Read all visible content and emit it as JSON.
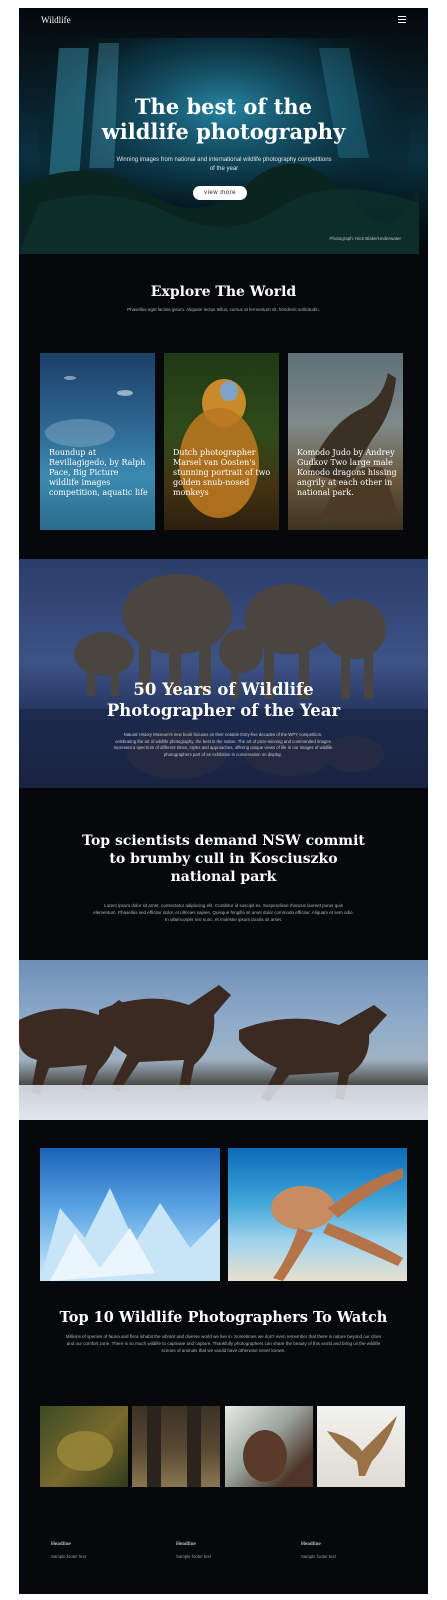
{
  "header": {
    "logo": "Wildlife",
    "menu_icon": "hamburger-menu-icon"
  },
  "hero": {
    "title_line1": "The best of the",
    "title_line2": "wildlife photography",
    "subtitle": "Winning images from national and international wildlife photography competitions of the year",
    "button_label": "view more",
    "credit": "Photograph: Nick Blake/Underwater"
  },
  "explore": {
    "title": "Explore The World",
    "text": "Phasellus eget lacinia ipsum. Aliquam lectus tellus, cursus at fermentum sit, hendrerit sollicitudin."
  },
  "cards": [
    {
      "caption": "Roundup at Revillagigedo, by Ralph Pace, Big Picture wildlife images competition, aquatic life"
    },
    {
      "caption": "Dutch photographer Marsel van Oosten's stunning portrait of two golden snub-nosed monkeys"
    },
    {
      "caption": "Komodo Judo by Andrey Gudkov Two large male Komodo dragons hissing angrily at each other in national park."
    }
  ],
  "feature": {
    "title_line1": "50 Years of Wildlife",
    "title_line2": "Photographer of the Year",
    "text": "Natural History Museum's new book focuses on their notable thirty-five decades of the WPY competition, celebrating the art of wildlife photography, the best in the nation. The art of prize-winning and commended images represent a spectrum of different times, styles and approaches, offering unique views of life in our images of wildlife photographers part of an exhibition in conversation on display."
  },
  "article": {
    "title_line1": "Top scientists demand NSW commit",
    "title_line2": "to brumby cull in Kosciuszko",
    "title_line3": "national park",
    "text": "Lorem ipsum dolor sit amet, consectetur adipiscing elit. Curabitur id suscipit ex. Suspendisse rhoncus laoreet purus quis elementum. Phasellus sed efficitur dolor, et ultricies sapien. Quisque fringilla sit amet dolor commodo efficitur. Aliquam et sem odio. In ullamcorper nisi nunc, et molestie ipsum iaculis sit amet."
  },
  "top10": {
    "title": "Top 10 Wildlife Photographers To Watch",
    "text": "Millions of species of fauna and flora inhabit the vibrant and diverse world we live in. Sometimes we don't even remember that there is nature beyond our cities and our comfort zone. There is so much wildlife to captivate and capture. Thankfully photographers can share the beauty of this world and bring us the wildlife scenes of animals that we would have otherwise never known."
  },
  "footer": [
    {
      "headline": "Headline",
      "text": "Sample footer text"
    },
    {
      "headline": "Headline",
      "text": "Sample footer text"
    },
    {
      "headline": "Headline",
      "text": "Sample footer text"
    }
  ]
}
